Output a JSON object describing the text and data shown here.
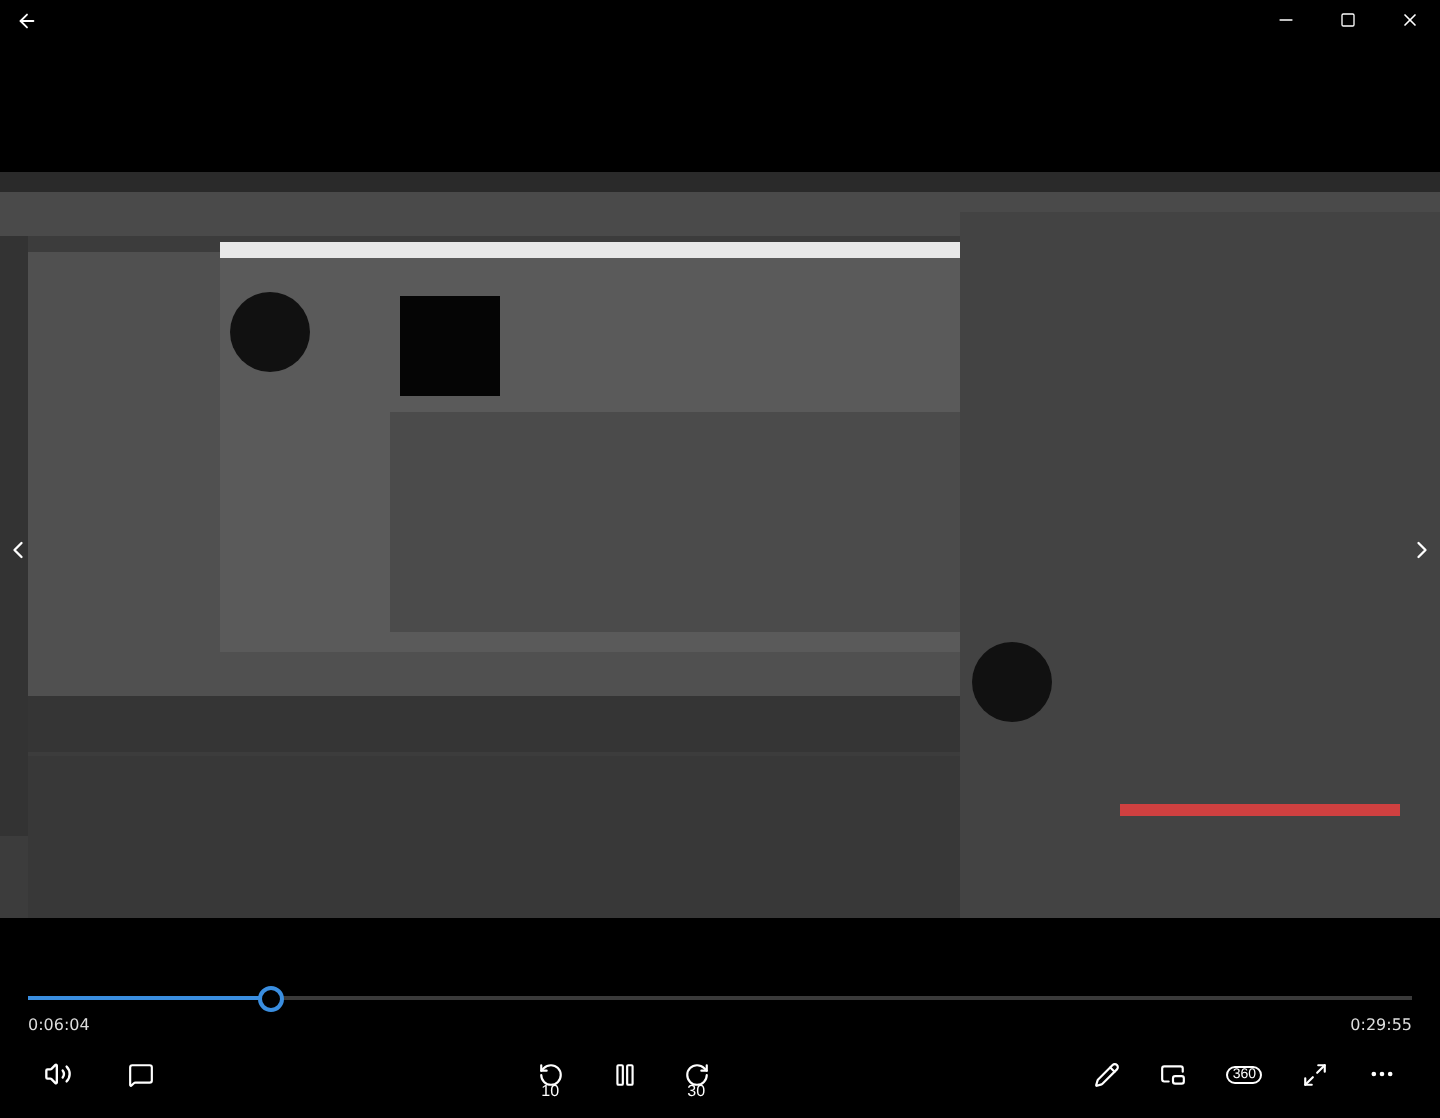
{
  "progress": {
    "level": 0.175,
    "elapsed": "0:06:04",
    "total": "0:29:55"
  },
  "controls": {
    "skip_back": "10",
    "skip_forward": "30",
    "view_360": "360",
    "playing": true
  }
}
